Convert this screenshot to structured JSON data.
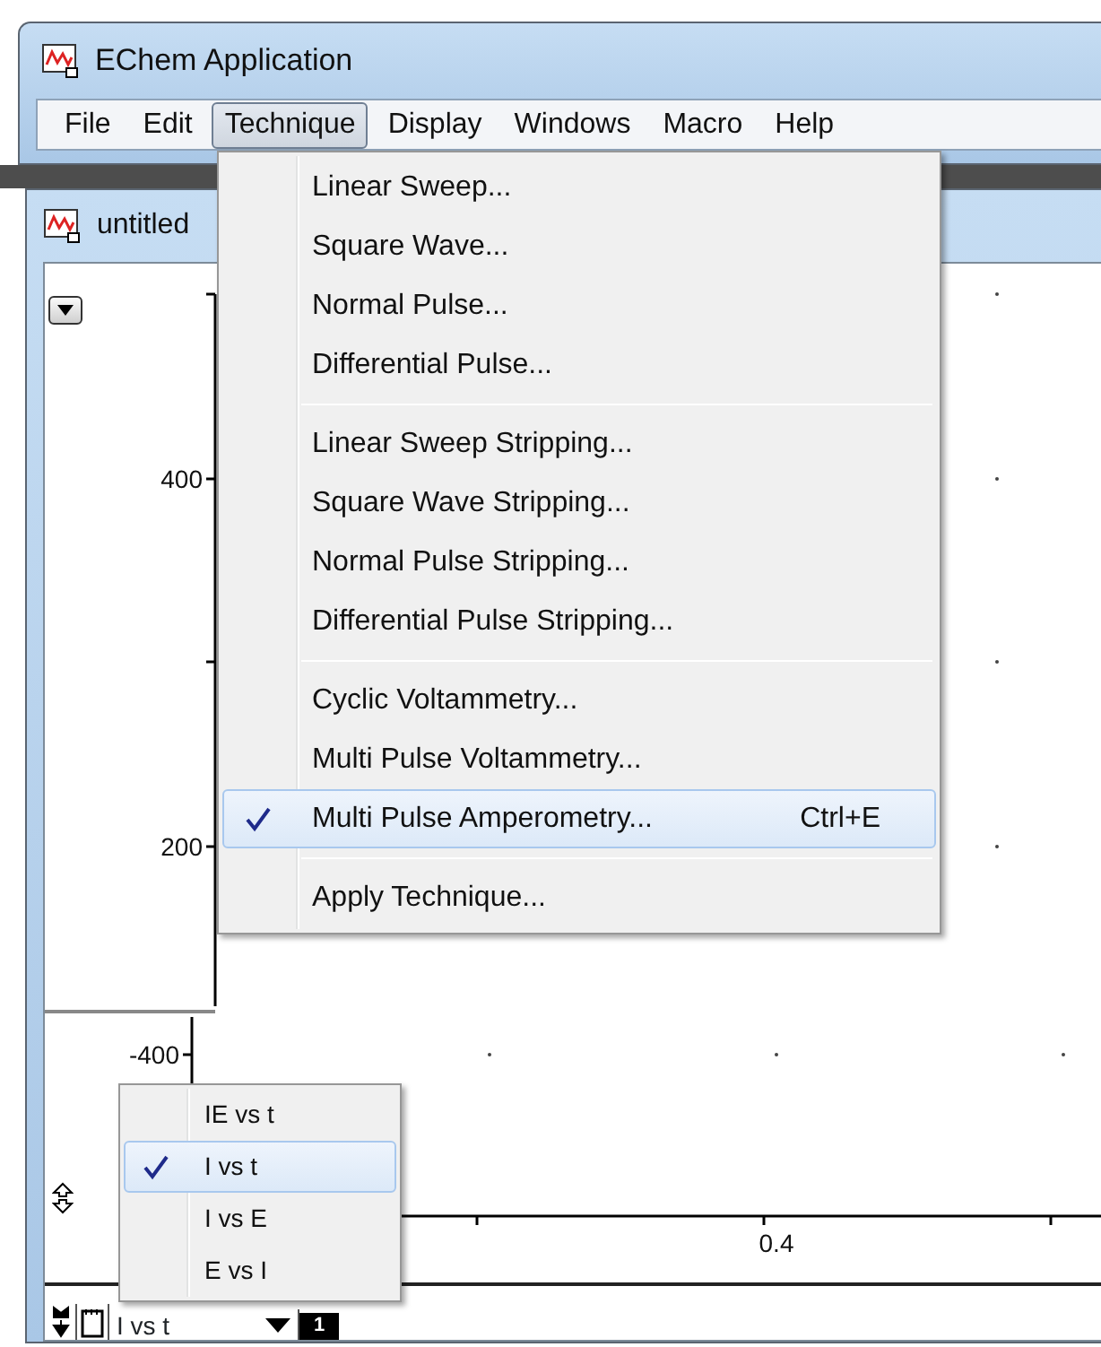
{
  "window": {
    "title": "EChem Application"
  },
  "menu_bar": [
    {
      "label": "File",
      "selected": false
    },
    {
      "label": "Edit",
      "selected": false
    },
    {
      "label": "Technique",
      "selected": true
    },
    {
      "label": "Display",
      "selected": false
    },
    {
      "label": "Windows",
      "selected": false
    },
    {
      "label": "Macro",
      "selected": false
    },
    {
      "label": "Help",
      "selected": false
    }
  ],
  "technique_menu": {
    "groups": [
      [
        {
          "label": "Linear Sweep...",
          "checked": false,
          "selected": false
        },
        {
          "label": "Square Wave...",
          "checked": false,
          "selected": false
        },
        {
          "label": "Normal Pulse...",
          "checked": false,
          "selected": false
        },
        {
          "label": "Differential Pulse...",
          "checked": false,
          "selected": false
        }
      ],
      [
        {
          "label": "Linear Sweep Stripping...",
          "checked": false,
          "selected": false
        },
        {
          "label": "Square Wave Stripping...",
          "checked": false,
          "selected": false
        },
        {
          "label": "Normal Pulse Stripping...",
          "checked": false,
          "selected": false
        },
        {
          "label": "Differential Pulse Stripping...",
          "checked": false,
          "selected": false
        }
      ],
      [
        {
          "label": "Cyclic Voltammetry...",
          "checked": false,
          "selected": false
        },
        {
          "label": "Multi Pulse Voltammetry...",
          "checked": false,
          "selected": false
        },
        {
          "label": "Multi Pulse Amperometry...",
          "checked": true,
          "selected": true,
          "shortcut": "Ctrl+E"
        }
      ],
      [
        {
          "label": "Apply Technique...",
          "checked": false,
          "selected": false
        }
      ]
    ]
  },
  "document_window": {
    "title": "untitled"
  },
  "upper_plot": {
    "y_tick_labels": [
      "400",
      "200"
    ]
  },
  "lower_plot": {
    "y_tick_labels": [
      "-400"
    ],
    "x_tick_labels": [
      "0.4"
    ]
  },
  "plot_type_menu": [
    {
      "label": "IE vs t",
      "checked": false,
      "selected": false
    },
    {
      "label": "I vs t",
      "checked": true,
      "selected": true
    },
    {
      "label": "I vs E",
      "checked": false,
      "selected": false
    },
    {
      "label": "E vs I",
      "checked": false,
      "selected": false
    }
  ],
  "status_bar": {
    "plot_type": "I vs t",
    "page": "1"
  }
}
